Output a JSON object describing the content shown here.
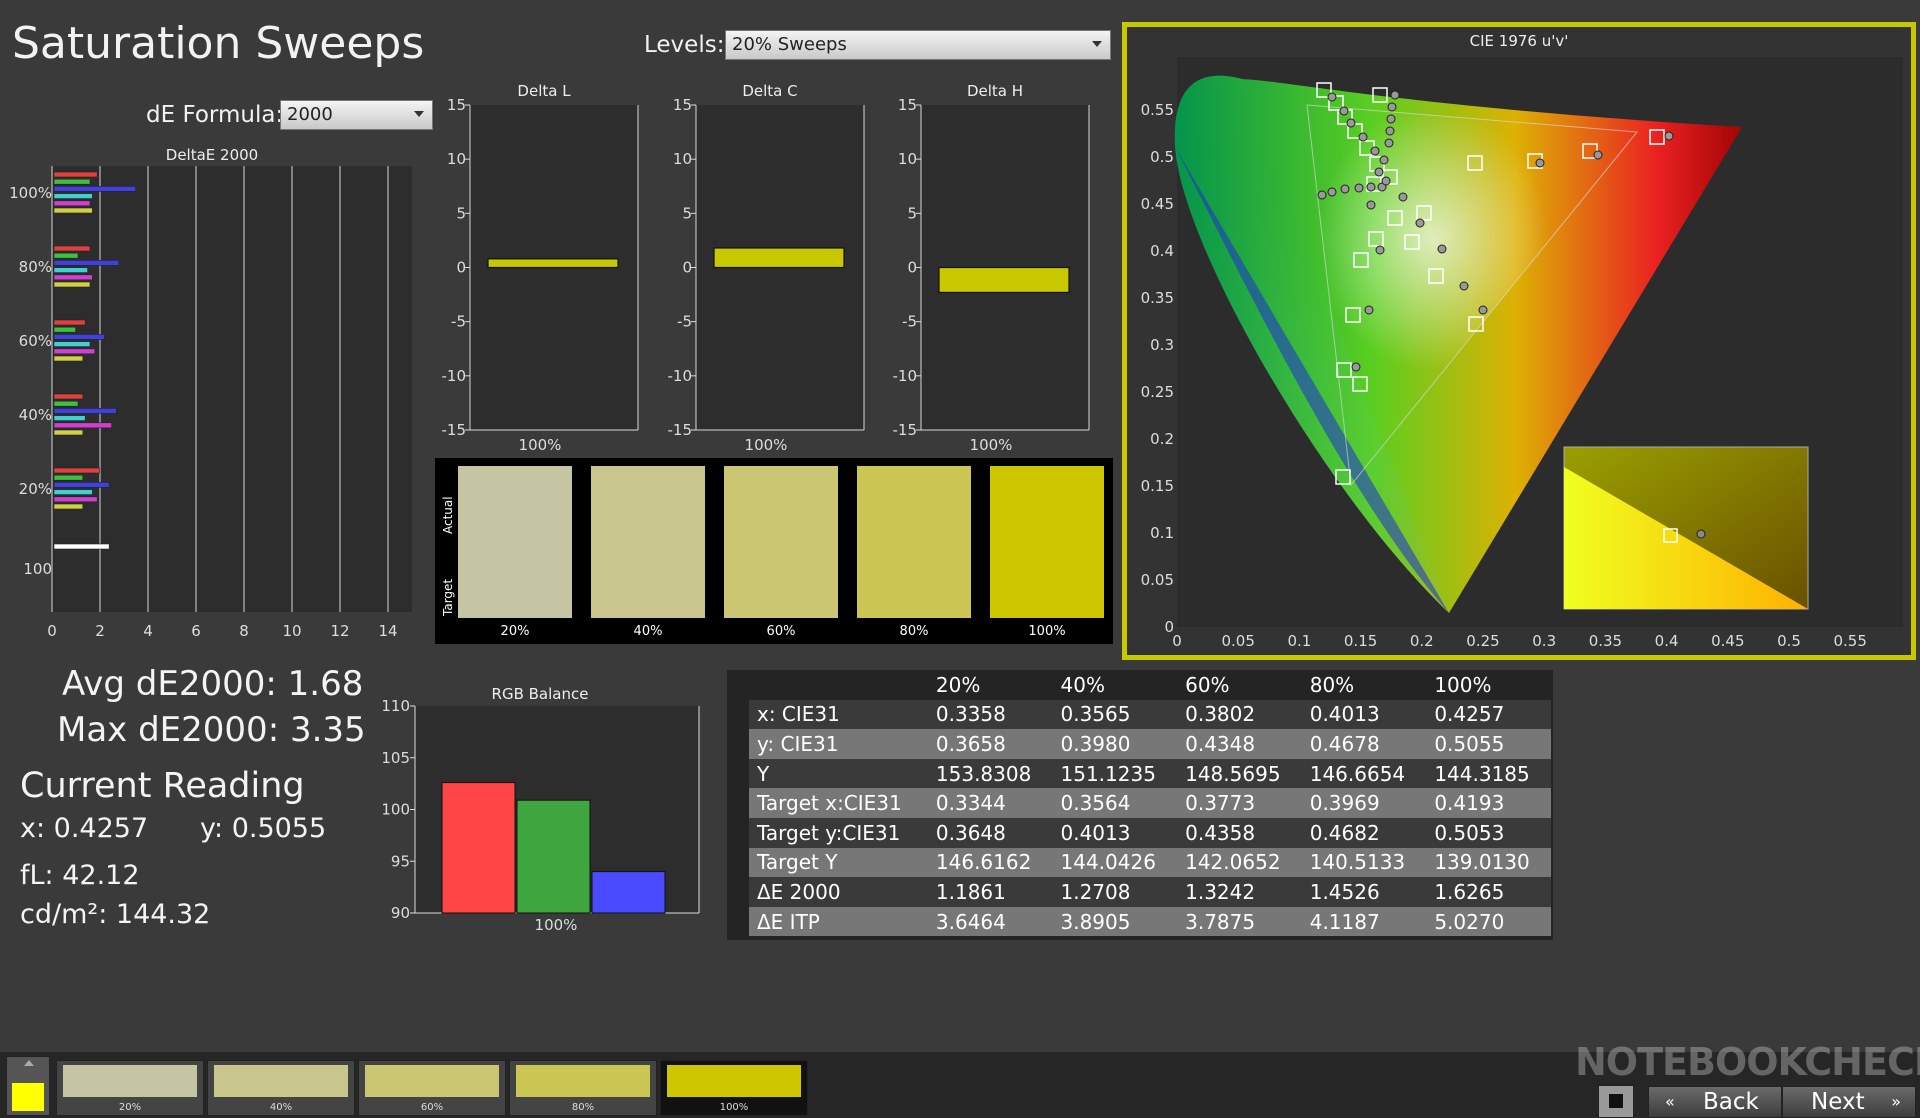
{
  "title": "Saturation Sweeps",
  "levels": {
    "label": "Levels:",
    "value": "20% Sweeps"
  },
  "de_formula": {
    "label": "dE Formula:",
    "value": "2000"
  },
  "deltaE_chart": {
    "title": "DeltaE 2000",
    "x_ticks": [
      "0",
      "2",
      "4",
      "6",
      "8",
      "10",
      "12",
      "14"
    ],
    "xlim": [
      0,
      15
    ],
    "groups": [
      {
        "label": "100%",
        "values": [
          1.8,
          1.5,
          3.4,
          1.6,
          1.5,
          1.6
        ]
      },
      {
        "label": "80%",
        "values": [
          1.5,
          1.0,
          2.7,
          1.4,
          1.6,
          1.5
        ]
      },
      {
        "label": "60%",
        "values": [
          1.3,
          0.9,
          2.1,
          1.5,
          1.7,
          1.2
        ]
      },
      {
        "label": "40%",
        "values": [
          1.2,
          1.0,
          2.6,
          1.3,
          2.4,
          1.2
        ]
      },
      {
        "label": "20%",
        "values": [
          1.9,
          1.2,
          2.3,
          1.6,
          1.8,
          1.2
        ]
      },
      {
        "label": "100",
        "values": [
          2.3
        ]
      }
    ],
    "colors": [
      "#e04040",
      "#40c040",
      "#4040e0",
      "#40d0d0",
      "#d040d0",
      "#d0d040"
    ]
  },
  "delta_charts": [
    {
      "title": "Delta L",
      "value": 0.8,
      "category": "100%"
    },
    {
      "title": "Delta C",
      "value": 1.8,
      "category": "100%"
    },
    {
      "title": "Delta H",
      "value": -2.3,
      "category": "100%"
    }
  ],
  "delta_ticks": [
    "15",
    "10",
    "5",
    "0",
    "-5",
    "-10",
    "-15"
  ],
  "swatches": {
    "actual_label": "Actual",
    "target_label": "Target",
    "items": [
      {
        "label": "20%",
        "color": "#c5c5a3"
      },
      {
        "label": "40%",
        "color": "#c8c68c"
      },
      {
        "label": "60%",
        "color": "#cac672"
      },
      {
        "label": "80%",
        "color": "#cbc653"
      },
      {
        "label": "100%",
        "color": "#cdc600"
      }
    ]
  },
  "cie": {
    "title": "CIE 1976 u'v'",
    "x_ticks": [
      "0",
      "0.05",
      "0.1",
      "0.15",
      "0.2",
      "0.25",
      "0.3",
      "0.35",
      "0.4",
      "0.45",
      "0.5",
      "0.55"
    ],
    "y_ticks": [
      "0",
      "0.05",
      "0.1",
      "0.15",
      "0.2",
      "0.25",
      "0.3",
      "0.35",
      "0.4",
      "0.45",
      "0.5",
      "0.55"
    ]
  },
  "stats": {
    "avg": "Avg dE2000: 1.68",
    "max": "Max dE2000: 3.35"
  },
  "reading": {
    "title": "Current Reading",
    "x": "x: 0.4257",
    "y": "y: 0.5055",
    "fl": "fL: 42.12",
    "cdm2": "cd/m²: 144.32"
  },
  "rgb_balance": {
    "title": "RGB Balance",
    "y_ticks": [
      "110",
      "105",
      "100",
      "95",
      "90"
    ],
    "ylim": [
      90,
      110
    ],
    "values": [
      102.6,
      100.9,
      94.0
    ],
    "colors": [
      "#ff4545",
      "#3fa53f",
      "#4a4aff"
    ],
    "category": "100%"
  },
  "table": {
    "headers": [
      "",
      "20%",
      "40%",
      "60%",
      "80%",
      "100%"
    ],
    "rows": [
      [
        "x: CIE31",
        "0.3358",
        "0.3565",
        "0.3802",
        "0.4013",
        "0.4257"
      ],
      [
        "y: CIE31",
        "0.3658",
        "0.3980",
        "0.4348",
        "0.4678",
        "0.5055"
      ],
      [
        "Y",
        "153.8308",
        "151.1235",
        "148.5695",
        "146.6654",
        "144.3185"
      ],
      [
        "Target x:CIE31",
        "0.3344",
        "0.3564",
        "0.3773",
        "0.3969",
        "0.4193"
      ],
      [
        "Target y:CIE31",
        "0.3648",
        "0.4013",
        "0.4358",
        "0.4682",
        "0.5053"
      ],
      [
        "Target Y",
        "146.6162",
        "144.0426",
        "142.0652",
        "140.5133",
        "139.0130"
      ],
      [
        "ΔE 2000",
        "1.1861",
        "1.2708",
        "1.3242",
        "1.4526",
        "1.6265"
      ],
      [
        "ΔE ITP",
        "3.6464",
        "3.8905",
        "3.7875",
        "4.1187",
        "5.0270"
      ]
    ]
  },
  "thumbs": [
    {
      "label": "20%",
      "color": "#c5c5a3"
    },
    {
      "label": "40%",
      "color": "#c8c68c"
    },
    {
      "label": "60%",
      "color": "#cac672"
    },
    {
      "label": "80%",
      "color": "#cbc653"
    },
    {
      "label": "100%",
      "color": "#cdc600"
    }
  ],
  "nav": {
    "back": "Back",
    "next": "Next"
  },
  "watermark": "NOTEBOOKCHECK"
}
